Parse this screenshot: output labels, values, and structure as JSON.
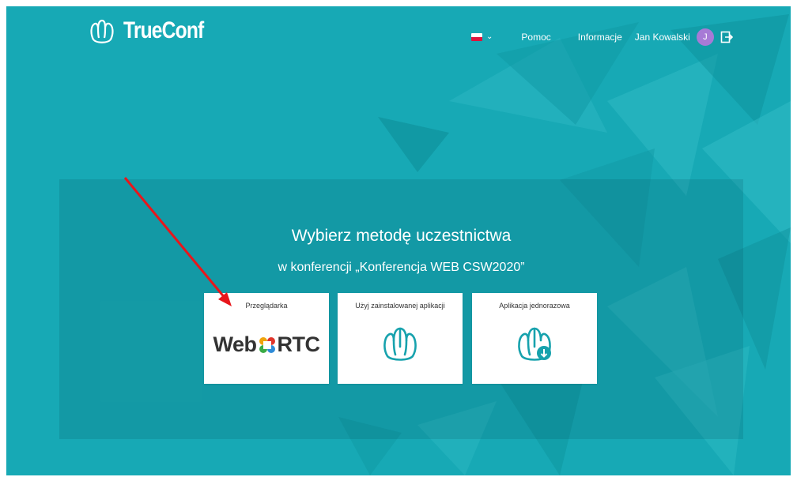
{
  "brand": {
    "name": "TrueConf"
  },
  "nav": {
    "language_icon": "flag-pl-icon",
    "help": "Pomoc",
    "info": "Informacje",
    "user_name": "Jan Kowalski",
    "avatar_initial": "J",
    "logout_icon": "logout-icon"
  },
  "main": {
    "title": "Wybierz metodę uczestnictwa",
    "subtitle": "w konferencji „Konferencja WEB CSW2020”",
    "options": [
      {
        "label": "Przeglądarka",
        "logo_left": "Web",
        "logo_right": "RTC"
      },
      {
        "label": "Użyj zainstalowanej aplikacji"
      },
      {
        "label": "Aplikacja jednorazowa"
      }
    ]
  },
  "colors": {
    "background": "#17a9b5",
    "avatar": "#a77ad6",
    "annotation_arrow": "#e8161b",
    "icon_teal": "#17a2ad"
  }
}
